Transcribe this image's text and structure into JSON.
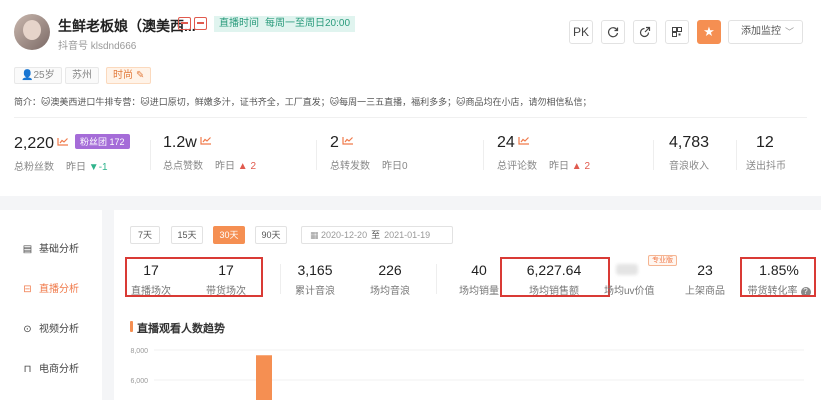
{
  "profile": {
    "name": "生鲜老板娘（澳美西...",
    "live_time_label": "直播时间",
    "live_time_value": "每周一至周日20:00",
    "account": "抖音号 klsdnd666",
    "tags": {
      "age": "25岁",
      "city": "苏州",
      "category": "时尚"
    },
    "intro": "简介：🐱澳美西进口牛排专营：🐱进口原切，鲜嫩多汁，证书齐全，工厂直发；🐱每周一三五直播，福利多多；🐱商品均在小店，请勿相信私信；",
    "actions": {
      "pk": "PK",
      "add_monitor": "添加监控"
    }
  },
  "stats": [
    {
      "value": "2,220",
      "label": "总粉丝数",
      "cmp_label": "昨日",
      "cmp_value": "-1",
      "dir": "down",
      "fans_club": "粉丝团 172"
    },
    {
      "value": "1.2w",
      "label": "总点赞数",
      "cmp_label": "昨日",
      "cmp_value": "2",
      "dir": "up"
    },
    {
      "value": "2",
      "label": "总转发数",
      "cmp_label": "昨日",
      "cmp_value": "0",
      "dir": "none"
    },
    {
      "value": "24",
      "label": "总评论数",
      "cmp_label": "昨日",
      "cmp_value": "2",
      "dir": "up"
    },
    {
      "value": "4,783",
      "label": "音浪收入"
    },
    {
      "value": "12",
      "label": "送出抖币"
    }
  ],
  "sidebar": {
    "items": [
      {
        "label": "基础分析"
      },
      {
        "label": "直播分析"
      },
      {
        "label": "视频分析"
      },
      {
        "label": "电商分析"
      }
    ]
  },
  "ranges": [
    "7天",
    "15天",
    "30天",
    "90天"
  ],
  "date_range": {
    "start": "2020-12-20",
    "end": "2021-01-19",
    "sep": "至"
  },
  "metrics": {
    "live_sessions": {
      "value": "17",
      "label": "直播场次"
    },
    "sales_sessions": {
      "value": "17",
      "label": "带货场次"
    },
    "total_audio_waves": {
      "value": "3,165",
      "label": "累计音浪"
    },
    "avg_audio_waves": {
      "value": "226",
      "label": "场均音浪"
    },
    "avg_sales_volume": {
      "value": "40",
      "label": "场均销量"
    },
    "avg_sales_amount": {
      "value": "6,227.64",
      "label": "场均销售额"
    },
    "avg_uv_value": {
      "value": "",
      "label": "场均uv价值",
      "badge": "专业版"
    },
    "products_listed": {
      "value": "23",
      "label": "上架商品"
    },
    "conversion_rate": {
      "value": "1.85%",
      "label": "带货转化率"
    }
  },
  "chart_title": "直播观看人数趋势",
  "chart_data": {
    "type": "bar",
    "title": "直播观看人数趋势",
    "y_ticks": [
      "8,000",
      "6,000"
    ],
    "ylim": [
      0,
      8000
    ],
    "visible_values": [
      7650
    ],
    "bar_color": "#f58f52"
  }
}
